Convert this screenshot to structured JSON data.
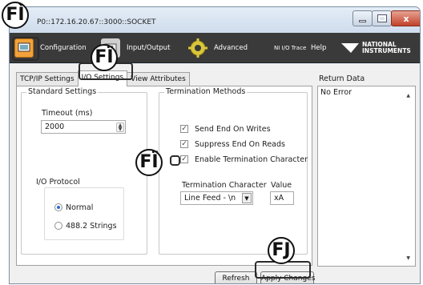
{
  "window": {
    "title": "P0::172.16.20.67::3000::SOCKET",
    "controls": {
      "close": "x"
    }
  },
  "toolbar": {
    "configuration": "Configuration",
    "input_output": "Input/Output",
    "advanced": "Advanced",
    "ni_io_trace": "NI I/O Trace",
    "help": "Help",
    "brand_line1": "NATIONAL",
    "brand_line2": "INSTRUMENTS"
  },
  "tabs": [
    "TCP/IP Settings",
    "I/O Settings",
    "View Attributes"
  ],
  "standard_settings": {
    "title": "Standard Settings",
    "timeout_label": "Timeout (ms)",
    "timeout_value": "2000",
    "io_protocol_label": "I/O Protocol",
    "protocol_options": [
      "Normal",
      "488.2 Strings"
    ],
    "selected_protocol": "Normal"
  },
  "termination": {
    "title": "Termination Methods",
    "checkboxes": [
      {
        "label": "Send End On Writes",
        "checked": true
      },
      {
        "label": "Suppress End On Reads",
        "checked": true
      },
      {
        "label": "Enable Termination Character",
        "checked": true
      }
    ],
    "termchar_label": "Termination Character",
    "termchar_value": "Line Feed - \\n",
    "value_label": "Value",
    "value_text": "xA"
  },
  "return_data": {
    "label": "Return Data",
    "text": "No Error"
  },
  "buttons": {
    "refresh": "Refresh",
    "apply": "Apply Changes"
  },
  "callouts": [
    "FÌ",
    "FÏ",
    "FÏ",
    "FJ"
  ],
  "colors": {
    "toolbar_bg": "#3a3a3a",
    "config_icon_bg": "#f2a23a",
    "advanced_icon": "#d9c63a",
    "window_frame": "#dce7f3"
  }
}
